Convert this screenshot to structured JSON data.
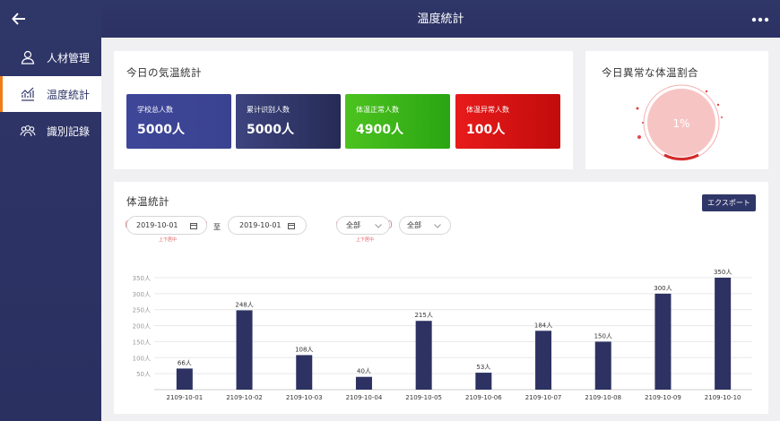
{
  "header": {
    "title": "温度統計",
    "back_icon": "arrow-left-icon",
    "more_icon": "more-dots-icon"
  },
  "sidebar": {
    "items": [
      {
        "label": "人材管理",
        "icon": "user-icon"
      },
      {
        "label": "温度統計",
        "icon": "chart-line-icon"
      },
      {
        "label": "識別記錄",
        "icon": "group-icon"
      }
    ]
  },
  "today_stats": {
    "title": "今日の気温統計",
    "cards": [
      {
        "label": "学校总人数",
        "value": "5000人",
        "color": "#3a4390"
      },
      {
        "label": "累计识别人数",
        "value": "5000人",
        "color": "#2d3262"
      },
      {
        "label": "体温正常人数",
        "value": "4900人",
        "color": "#33b018"
      },
      {
        "label": "体温异常人数",
        "value": "100人",
        "color": "#d11212"
      }
    ]
  },
  "abnormal": {
    "title": "今日異常な体温割合",
    "percent": "1%",
    "fraction": 0.01
  },
  "temp_stats": {
    "title": "体温統計",
    "export_label": "エクスポート",
    "date_start": "2019-10-01",
    "date_end": "2019-10-01",
    "range_sep": "至",
    "filter1": "全部",
    "filter2": "全部",
    "note1": "上下居中",
    "note2": "上下居中"
  },
  "chart_data": {
    "type": "bar",
    "categories": [
      "2109-10-01",
      "2109-10-02",
      "2109-10-03",
      "2109-10-04",
      "2109-10-05",
      "2109-10-06",
      "2109-10-07",
      "2109-10-08",
      "2109-10-09",
      "2109-10-10"
    ],
    "values": [
      66,
      248,
      108,
      40,
      215,
      53,
      184,
      150,
      300,
      350
    ],
    "value_labels": [
      "66人",
      "248人",
      "108人",
      "40人",
      "215人",
      "53人",
      "184人",
      "150人",
      "300人",
      "350人"
    ],
    "yticks": [
      50,
      100,
      150,
      200,
      250,
      300,
      350
    ],
    "ytick_labels": [
      "50人",
      "100人",
      "150人",
      "200人",
      "250人",
      "300人",
      "350人"
    ],
    "ylim": [
      0,
      350
    ],
    "grid": true,
    "bar_color": "#2d3262"
  }
}
